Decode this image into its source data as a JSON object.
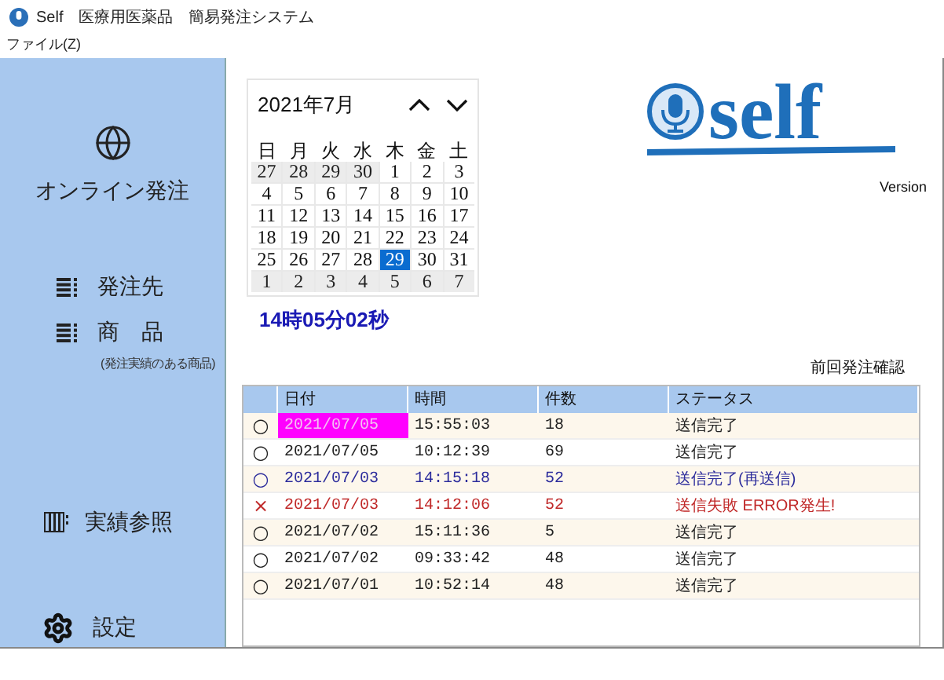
{
  "window": {
    "title": "Self　医療用医薬品　簡易発注システム"
  },
  "menu": [
    "ファイル(Z)"
  ],
  "sidebar": {
    "items": [
      {
        "kind": "online",
        "label": "オンライン発注"
      },
      {
        "kind": "list",
        "label": "発注先"
      },
      {
        "kind": "list",
        "label": "商　品",
        "note": "(発注実績のある商品)"
      },
      {
        "kind": "records",
        "label": "実績参照"
      },
      {
        "kind": "settings",
        "label": "設定"
      }
    ]
  },
  "calendar": {
    "month": "2021年7月",
    "weekdays": [
      "日",
      "月",
      "火",
      "水",
      "木",
      "金",
      "土"
    ],
    "weeks": [
      [
        {
          "day": "27",
          "outside": true,
          "selected": false
        },
        {
          "day": "28",
          "outside": true,
          "selected": false
        },
        {
          "day": "29",
          "outside": true,
          "selected": false
        },
        {
          "day": "30",
          "outside": true,
          "selected": false
        },
        {
          "day": "1",
          "outside": false,
          "selected": false
        },
        {
          "day": "2",
          "outside": false,
          "selected": false
        },
        {
          "day": "3",
          "outside": false,
          "selected": false
        }
      ],
      [
        {
          "day": "4",
          "outside": false,
          "selected": false
        },
        {
          "day": "5",
          "outside": false,
          "selected": false
        },
        {
          "day": "6",
          "outside": false,
          "selected": false
        },
        {
          "day": "7",
          "outside": false,
          "selected": false
        },
        {
          "day": "8",
          "outside": false,
          "selected": false
        },
        {
          "day": "9",
          "outside": false,
          "selected": false
        },
        {
          "day": "10",
          "outside": false,
          "selected": false
        }
      ],
      [
        {
          "day": "11",
          "outside": false,
          "selected": false
        },
        {
          "day": "12",
          "outside": false,
          "selected": false
        },
        {
          "day": "13",
          "outside": false,
          "selected": false
        },
        {
          "day": "14",
          "outside": false,
          "selected": false
        },
        {
          "day": "15",
          "outside": false,
          "selected": false
        },
        {
          "day": "16",
          "outside": false,
          "selected": false
        },
        {
          "day": "17",
          "outside": false,
          "selected": false
        }
      ],
      [
        {
          "day": "18",
          "outside": false,
          "selected": false
        },
        {
          "day": "19",
          "outside": false,
          "selected": false
        },
        {
          "day": "20",
          "outside": false,
          "selected": false
        },
        {
          "day": "21",
          "outside": false,
          "selected": false
        },
        {
          "day": "22",
          "outside": false,
          "selected": false
        },
        {
          "day": "23",
          "outside": false,
          "selected": false
        },
        {
          "day": "24",
          "outside": false,
          "selected": false
        }
      ],
      [
        {
          "day": "25",
          "outside": false,
          "selected": false
        },
        {
          "day": "26",
          "outside": false,
          "selected": false
        },
        {
          "day": "27",
          "outside": false,
          "selected": false
        },
        {
          "day": "28",
          "outside": false,
          "selected": false
        },
        {
          "day": "29",
          "outside": false,
          "selected": true
        },
        {
          "day": "30",
          "outside": false,
          "selected": false
        },
        {
          "day": "31",
          "outside": false,
          "selected": false
        }
      ],
      [
        {
          "day": "1",
          "outside": true,
          "selected": false
        },
        {
          "day": "2",
          "outside": true,
          "selected": false
        },
        {
          "day": "3",
          "outside": true,
          "selected": false
        },
        {
          "day": "4",
          "outside": true,
          "selected": false
        },
        {
          "day": "5",
          "outside": true,
          "selected": false
        },
        {
          "day": "6",
          "outside": true,
          "selected": false
        },
        {
          "day": "7",
          "outside": true,
          "selected": false
        }
      ]
    ]
  },
  "clock": "14時05分02秒",
  "logo": {
    "text": "self",
    "version": "Version"
  },
  "history": {
    "title": "前回発注確認",
    "columns": [
      "日付",
      "時間",
      "件数",
      "ステータス"
    ],
    "rows": [
      {
        "mark": "○",
        "kind": "ok",
        "selected": true,
        "date": "2021/07/05",
        "time": "15:55:03",
        "count": "18",
        "status": "送信完了"
      },
      {
        "mark": "○",
        "kind": "ok",
        "selected": false,
        "date": "2021/07/05",
        "time": "10:12:39",
        "count": "69",
        "status": "送信完了"
      },
      {
        "mark": "○",
        "kind": "resent",
        "selected": false,
        "date": "2021/07/03",
        "time": "14:15:18",
        "count": "52",
        "status": "送信完了(再送信)"
      },
      {
        "mark": "×",
        "kind": "error",
        "selected": false,
        "date": "2021/07/03",
        "time": "14:12:06",
        "count": "52",
        "status": "送信失敗 ERROR発生!"
      },
      {
        "mark": "○",
        "kind": "ok",
        "selected": false,
        "date": "2021/07/02",
        "time": "15:11:36",
        "count": "5",
        "status": "送信完了"
      },
      {
        "mark": "○",
        "kind": "ok",
        "selected": false,
        "date": "2021/07/02",
        "time": "09:33:42",
        "count": "48",
        "status": "送信完了"
      },
      {
        "mark": "○",
        "kind": "ok",
        "selected": false,
        "date": "2021/07/01",
        "time": "10:52:14",
        "count": "48",
        "status": "送信完了"
      }
    ]
  }
}
